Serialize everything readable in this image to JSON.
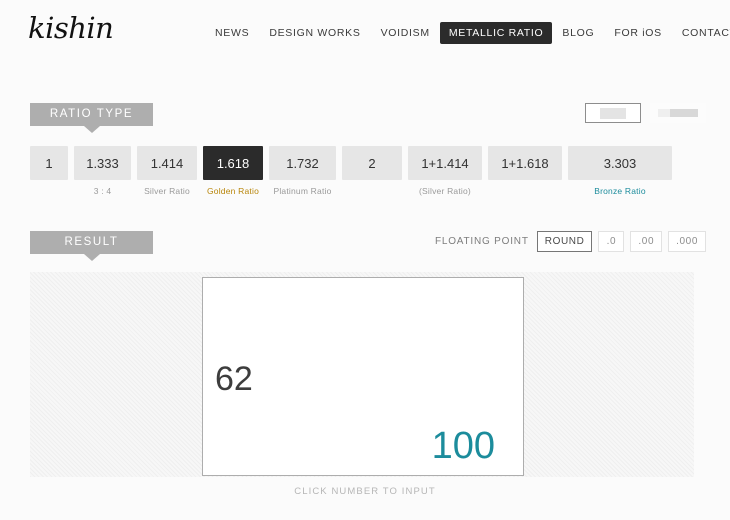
{
  "site": {
    "logo_text": "kishin"
  },
  "nav": {
    "items": [
      {
        "label": "NEWS",
        "active": false
      },
      {
        "label": "DESIGN WORKS",
        "active": false
      },
      {
        "label": "VOIDISM",
        "active": false
      },
      {
        "label": "METALLIC RATIO",
        "active": true
      },
      {
        "label": "BLOG",
        "active": false
      },
      {
        "label": "FOR iOS",
        "active": false
      },
      {
        "label": "CONTACT",
        "active": false
      }
    ]
  },
  "ratio_section": {
    "tag_label": "RATIO TYPE",
    "items": [
      {
        "value": "1",
        "sub": "",
        "selected": false,
        "sub_style": "plain"
      },
      {
        "value": "1.333",
        "sub": "3 : 4",
        "selected": false,
        "sub_style": "plain"
      },
      {
        "value": "1.414",
        "sub": "Silver Ratio",
        "selected": false,
        "sub_style": "plain"
      },
      {
        "value": "1.618",
        "sub": "Golden Ratio",
        "selected": true,
        "sub_style": "gold"
      },
      {
        "value": "1.732",
        "sub": "Platinum Ratio",
        "selected": false,
        "sub_style": "plain"
      },
      {
        "value": "2",
        "sub": "",
        "selected": false,
        "sub_style": "plain"
      },
      {
        "value": "1+1.414",
        "sub": "(Silver Ratio)",
        "selected": false,
        "sub_style": "plain"
      },
      {
        "value": "1+1.618",
        "sub": "",
        "selected": false,
        "sub_style": "plain"
      },
      {
        "value": "3.303",
        "sub": "Bronze Ratio",
        "selected": false,
        "sub_style": "bronze"
      }
    ]
  },
  "view_modes": {
    "items": [
      {
        "icon": "orientation-landscape-icon",
        "selected": true
      },
      {
        "icon": "orientation-wide-icon",
        "selected": false
      }
    ]
  },
  "result_section": {
    "tag_label": "RESULT",
    "floating_point": {
      "label": "FLOATING POINT",
      "options": [
        {
          "label": "ROUND",
          "selected": true
        },
        {
          "label": ".0",
          "selected": false
        },
        {
          "label": ".00",
          "selected": false
        },
        {
          "label": ".000",
          "selected": false
        }
      ]
    },
    "canvas": {
      "value_secondary": "62",
      "value_primary": "100"
    },
    "caption": "CLICK NUMBER TO INPUT"
  },
  "colors": {
    "accent_teal": "#1c8c9c",
    "accent_gold": "#b8860b",
    "selected_dark": "#2b2b2b",
    "tag_grey": "#aeaeae"
  }
}
